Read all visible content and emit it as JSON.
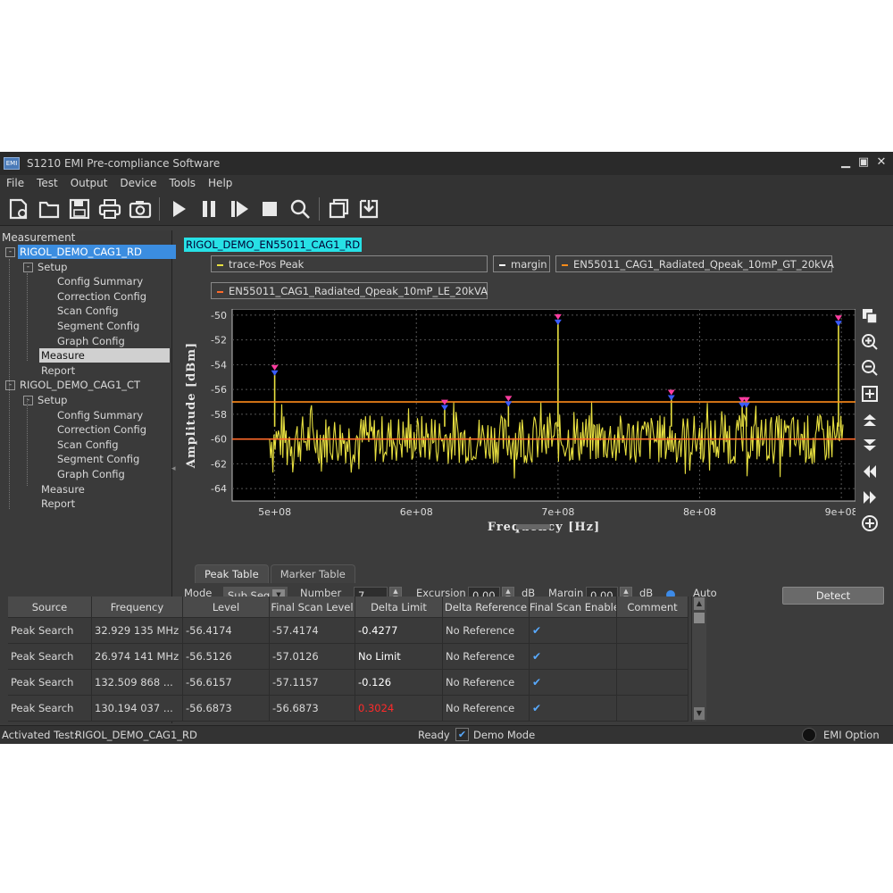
{
  "window": {
    "icon_text": "EMI",
    "title": "S1210 EMI Pre-compliance Software"
  },
  "menu": [
    "File",
    "Test",
    "Output",
    "Device",
    "Tools",
    "Help"
  ],
  "tree": {
    "header": "Measurement",
    "items": [
      {
        "label": "RIGOL_DEMO_CAG1_RD",
        "level": 0,
        "toggle": "-",
        "state": "selected"
      },
      {
        "label": "Setup",
        "level": 1,
        "toggle": "-",
        "state": ""
      },
      {
        "label": "Config Summary",
        "level": 2,
        "toggle": "",
        "state": ""
      },
      {
        "label": "Correction Config",
        "level": 2,
        "toggle": "",
        "state": ""
      },
      {
        "label": "Scan Config",
        "level": 2,
        "toggle": "",
        "state": ""
      },
      {
        "label": "Segment Config",
        "level": 2,
        "toggle": "",
        "state": ""
      },
      {
        "label": "Graph Config",
        "level": 2,
        "toggle": "",
        "state": ""
      },
      {
        "label": "Measure",
        "level": 1,
        "toggle": "",
        "state": "highlight"
      },
      {
        "label": "Report",
        "level": 1,
        "toggle": "",
        "state": ""
      },
      {
        "label": "RIGOL_DEMO_CAG1_CT",
        "level": 0,
        "toggle": "-",
        "state": ""
      },
      {
        "label": "Setup",
        "level": 1,
        "toggle": "-",
        "state": ""
      },
      {
        "label": "Config Summary",
        "level": 2,
        "toggle": "",
        "state": ""
      },
      {
        "label": "Correction Config",
        "level": 2,
        "toggle": "",
        "state": ""
      },
      {
        "label": "Scan Config",
        "level": 2,
        "toggle": "",
        "state": ""
      },
      {
        "label": "Segment Config",
        "level": 2,
        "toggle": "",
        "state": ""
      },
      {
        "label": "Graph Config",
        "level": 2,
        "toggle": "",
        "state": ""
      },
      {
        "label": "Measure",
        "level": 1,
        "toggle": "",
        "state": ""
      },
      {
        "label": "Report",
        "level": 1,
        "toggle": "",
        "state": ""
      }
    ]
  },
  "trace_title": "RIGOL_DEMO_EN55011_CAG1_RD",
  "legend": [
    {
      "label": "trace-Pos Peak",
      "color": "#e8e040"
    },
    {
      "label": "margin",
      "color": "#ffffff"
    },
    {
      "label": "EN55011_CAG1_Radiated_Qpeak_10mP_GT_20kVA",
      "color": "#ff8c1a"
    },
    {
      "label": "EN55011_CAG1_Radiated_Qpeak_10mP_LE_20kVA",
      "color": "#ff6a2a"
    }
  ],
  "chart_data": {
    "type": "line",
    "xlabel": "Frequency [Hz]",
    "ylabel": "Amplitude [dBm]",
    "xlim": [
      470000000,
      910000000
    ],
    "ylim": [
      -65,
      -49.5
    ],
    "xticks": [
      "5e+08",
      "6e+08",
      "7e+08",
      "8e+08",
      "9e+08"
    ],
    "xtick_values": [
      500000000,
      600000000,
      700000000,
      800000000,
      900000000
    ],
    "yticks": [
      -50,
      -52,
      -54,
      -56,
      -58,
      -60,
      -62,
      -64
    ],
    "grid": true,
    "noise_floor_dbm": -60,
    "noise_spread_db": 2,
    "limit_lines": [
      {
        "name": "EN55011_CAG1_Radiated_Qpeak_10mP_GT_20kVA",
        "y": -57,
        "color": "#ff8c1a"
      },
      {
        "name": "EN55011_CAG1_Radiated_Qpeak_10mP_LE_20kVA",
        "y": -60,
        "color": "#ff6a2a"
      }
    ],
    "peaks": [
      {
        "x": 500000000,
        "y": -54.6
      },
      {
        "x": 620000000,
        "y": -57.4
      },
      {
        "x": 665000000,
        "y": -57.1
      },
      {
        "x": 700000000,
        "y": -50.5
      },
      {
        "x": 780000000,
        "y": -56.6
      },
      {
        "x": 830000000,
        "y": -57.2
      },
      {
        "x": 833000000,
        "y": -57.2
      },
      {
        "x": 898000000,
        "y": -50.6
      }
    ],
    "trace_color": "#e8e040",
    "marker_colors": {
      "peak": "#ff3ca0",
      "final": "#3a5cff"
    }
  },
  "tabs": [
    "Peak Table",
    "Marker Table"
  ],
  "controls": {
    "mode_label": "Mode",
    "mode_value": "Sub Seg",
    "number_label": "Number",
    "number_value": "7",
    "excursion_label": "Excursion",
    "excursion_value": "0.00",
    "excursion_unit": "dB",
    "margin_label": "Margin",
    "margin_value": "0.00",
    "margin_unit": "dB",
    "auto_label": "Auto",
    "detect_label": "Detect"
  },
  "table": {
    "headers": [
      "Source",
      "Frequency",
      "Level",
      "Final Scan Level",
      "Delta Limit",
      "Delta Reference",
      "Final Scan Enable",
      "Comment"
    ],
    "rows": [
      {
        "source": "Peak Search",
        "frequency": "32.929 135 MHz",
        "level": "-56.4174",
        "final_scan_level": "-57.4174",
        "delta_limit": "-0.4277",
        "delta_style": "white",
        "delta_reference": "No Reference",
        "enable": "✔",
        "comment": ""
      },
      {
        "source": "Peak Search",
        "frequency": "26.974 141 MHz",
        "level": "-56.5126",
        "final_scan_level": "-57.0126",
        "delta_limit": "No Limit",
        "delta_style": "white",
        "delta_reference": "No Reference",
        "enable": "✔",
        "comment": ""
      },
      {
        "source": "Peak Search",
        "frequency": "132.509 868 ...",
        "level": "-56.6157",
        "final_scan_level": "-57.1157",
        "delta_limit": "-0.126",
        "delta_style": "white",
        "delta_reference": "No Reference",
        "enable": "✔",
        "comment": ""
      },
      {
        "source": "Peak Search",
        "frequency": "130.194 037 ...",
        "level": "-56.6873",
        "final_scan_level": "-56.6873",
        "delta_limit": "0.3024",
        "delta_style": "red",
        "delta_reference": "No Reference",
        "enable": "✔",
        "comment": ""
      }
    ]
  },
  "status": {
    "activated_label": "Activated Test:",
    "activated_value": "RIGOL_DEMO_CAG1_RD",
    "ready": "Ready",
    "demo_mode": "Demo Mode",
    "emi_option": "EMI Option"
  }
}
